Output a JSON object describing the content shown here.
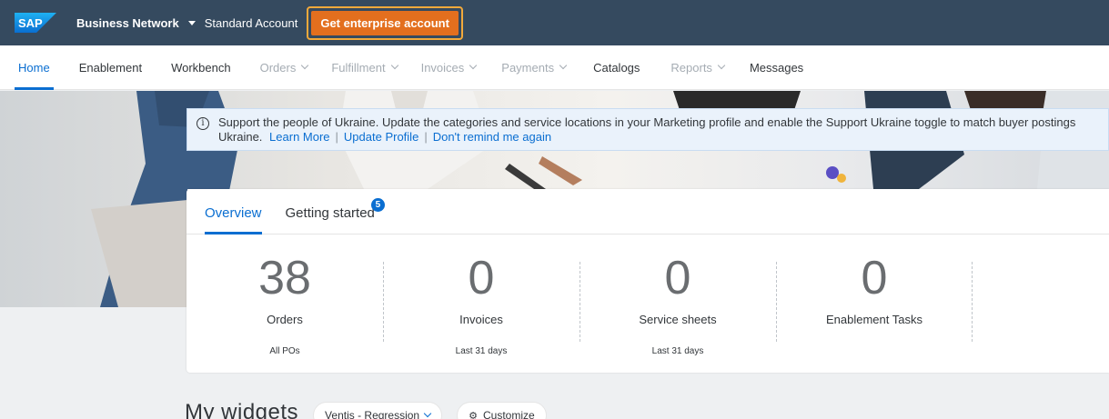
{
  "shell": {
    "logo": "SAP",
    "brand": "Business Network",
    "account": "Standard Account",
    "enterprise_button": "Get enterprise account"
  },
  "nav": {
    "items": [
      {
        "label": "Home",
        "state": "active"
      },
      {
        "label": "Enablement",
        "state": "normal"
      },
      {
        "label": "Workbench",
        "state": "normal"
      },
      {
        "label": "Orders",
        "state": "disabled",
        "dropdown": true
      },
      {
        "label": "Fulfillment",
        "state": "disabled",
        "dropdown": true
      },
      {
        "label": "Invoices",
        "state": "disabled",
        "dropdown": true
      },
      {
        "label": "Payments",
        "state": "disabled",
        "dropdown": true
      },
      {
        "label": "Catalogs",
        "state": "normal"
      },
      {
        "label": "Reports",
        "state": "disabled",
        "dropdown": true
      },
      {
        "label": "Messages",
        "state": "normal"
      }
    ]
  },
  "banner": {
    "line1": "Support the people of Ukraine. Update the categories and service locations in your Marketing profile and enable the Support Ukraine toggle to match buyer postings",
    "line2_prefix": "Ukraine.",
    "learn_more": "Learn More",
    "update_profile": "Update Profile",
    "dont_remind": "Don't remind me again",
    "separator": "|"
  },
  "overview": {
    "tabs": [
      {
        "label": "Overview",
        "active": true
      },
      {
        "label": "Getting started",
        "badge": "5"
      }
    ],
    "tiles": [
      {
        "value": "38",
        "label": "Orders",
        "sub": "All POs"
      },
      {
        "value": "0",
        "label": "Invoices",
        "sub": "Last 31 days"
      },
      {
        "value": "0",
        "label": "Service sheets",
        "sub": "Last 31 days"
      },
      {
        "value": "0",
        "label": "Enablement Tasks",
        "sub": ""
      }
    ]
  },
  "widgets": {
    "title": "My widgets",
    "filter": "Ventis - Regression",
    "customize": "Customize"
  },
  "colors": {
    "shell": "#354a5f",
    "accent": "#0a6ed1",
    "enterprise": "#e36f1e",
    "enterprise_outline": "#f2a93b"
  }
}
